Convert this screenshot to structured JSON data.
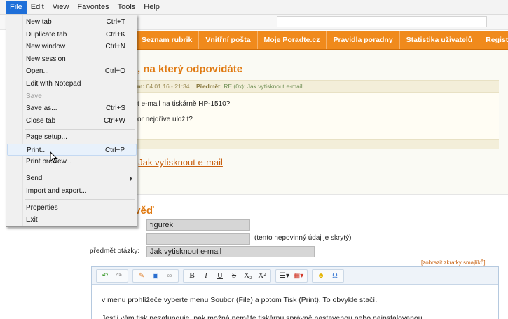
{
  "menubar": {
    "items": [
      "File",
      "Edit",
      "View",
      "Favorites",
      "Tools",
      "Help"
    ],
    "active": "File"
  },
  "file_menu": {
    "items": [
      {
        "label": "New tab",
        "shortcut": "Ctrl+T"
      },
      {
        "label": "Duplicate tab",
        "shortcut": "Ctrl+K"
      },
      {
        "label": "New window",
        "shortcut": "Ctrl+N"
      },
      {
        "label": "New session",
        "shortcut": ""
      },
      {
        "label": "Open...",
        "shortcut": "Ctrl+O"
      },
      {
        "label": "Edit with Notepad",
        "shortcut": ""
      },
      {
        "label": "Save",
        "shortcut": "",
        "disabled": true
      },
      {
        "label": "Save as...",
        "shortcut": "Ctrl+S"
      },
      {
        "label": "Close tab",
        "shortcut": "Ctrl+W"
      },
      {
        "label": "Page setup...",
        "shortcut": ""
      },
      {
        "label": "Print...",
        "shortcut": "Ctrl+P",
        "hovered": true
      },
      {
        "label": "Print preview...",
        "shortcut": ""
      },
      {
        "label": "Send",
        "shortcut": "",
        "submenu": true
      },
      {
        "label": "Import and export...",
        "shortcut": ""
      },
      {
        "label": "Properties",
        "shortcut": ""
      },
      {
        "label": "Exit",
        "shortcut": ""
      }
    ]
  },
  "site_nav": {
    "items": [
      "Seznam rubrik",
      "Vnitřní pošta",
      "Moje Poradte.cz",
      "Pravidla poradny",
      "Statistika uživatelů",
      "Registrace"
    ]
  },
  "original_question": {
    "title": ", na který odpovídáte",
    "meta_author_tail": "t",
    "meta_date_label": "Datum:",
    "meta_date_value": "04.01.16 - 21:34",
    "meta_subject_label": "Předmět:",
    "meta_subject_value": "RE (0x): Jak vytisknout e-mail",
    "body_line1": "t e-mail na tiskárně HP-1510?",
    "body_line2": "or nejdříve uložit?",
    "link_prefix": ":",
    "link_text": "Jak vytisknout e-mail"
  },
  "reply": {
    "title": "ověď",
    "name_value": "figurek",
    "hidden_field_value": "",
    "hidden_note": "(tento nepovinný údaj je skrytý)",
    "subject_label": "předmět otázky:",
    "subject_value": "Jak vytisknout e-mail",
    "smiley_link": "[zobrazit zkratky smajlíků]",
    "editor_line1": "v menu prohlížeče vyberte menu Soubor (File) a potom Tisk (Print). To obvykle stačí.",
    "editor_line2": "Jestli vám tisk nezafunguje, pak možná nemáte tiskárnu správně nastavenou nebo nainstalovanou."
  },
  "toolbar": {
    "bold": "B",
    "italic": "I",
    "underline": "U",
    "strike": "S",
    "subscript": "X₂",
    "superscript": "X²",
    "omega": "Ω"
  },
  "colors": {
    "nav_orange": "#f08a1c",
    "heading_orange": "#e07a12",
    "menu_highlight": "#1e6fd9"
  }
}
